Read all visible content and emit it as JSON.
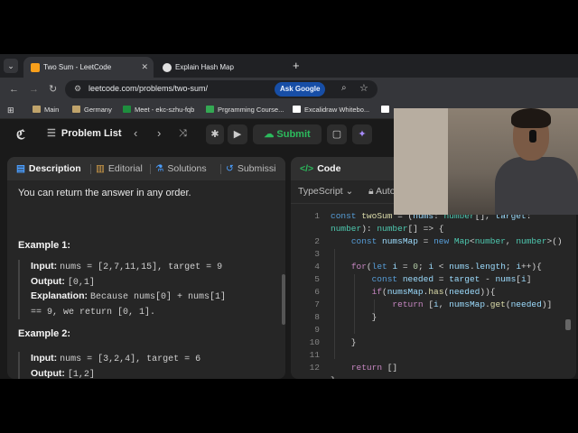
{
  "browser": {
    "tabs": [
      {
        "label": "Two Sum - LeetCode",
        "active": true,
        "close": "✕"
      },
      {
        "label": "Explain Hash Map",
        "active": false
      }
    ],
    "new_tab": "+",
    "url": "leetcode.com/problems/two-sum/",
    "ask_google": "Ask Google",
    "bookmarks": [
      "Main",
      "Germany",
      "Meet - ekc-szhu-fqb",
      "Prgramming Course...",
      "Excalidraw Whitebo..."
    ]
  },
  "header": {
    "problem_list": "Problem List",
    "submit": "Submit"
  },
  "left_panel": {
    "tabs": [
      "Description",
      "Editorial",
      "Solutions",
      "Submissi"
    ],
    "intro": "You can return the answer in any order.",
    "example1": {
      "title": "Example 1:",
      "input_label": "Input:",
      "input": "nums = [2,7,11,15], target = 9",
      "output_label": "Output:",
      "output": "[0,1]",
      "expl_label": "Explanation:",
      "expl1": "Because nums[0] + nums[1]",
      "expl2": "== 9, we return [0, 1]."
    },
    "example2": {
      "title": "Example 2:",
      "input_label": "Input:",
      "input": "nums = [3,2,4], target = 6",
      "output_label": "Output:",
      "output": "[1,2]"
    }
  },
  "right_panel": {
    "title": "Code",
    "language": "TypeScript",
    "mode": "Auto",
    "line_numbers": [
      "1",
      "2",
      "3",
      "4",
      "5",
      "6",
      "7",
      "8",
      "9",
      "10",
      "11",
      "12"
    ]
  },
  "colors": {
    "submit_green": "#2cbb5d",
    "accent_blue": "#569cd6",
    "panel_bg": "#262626"
  }
}
